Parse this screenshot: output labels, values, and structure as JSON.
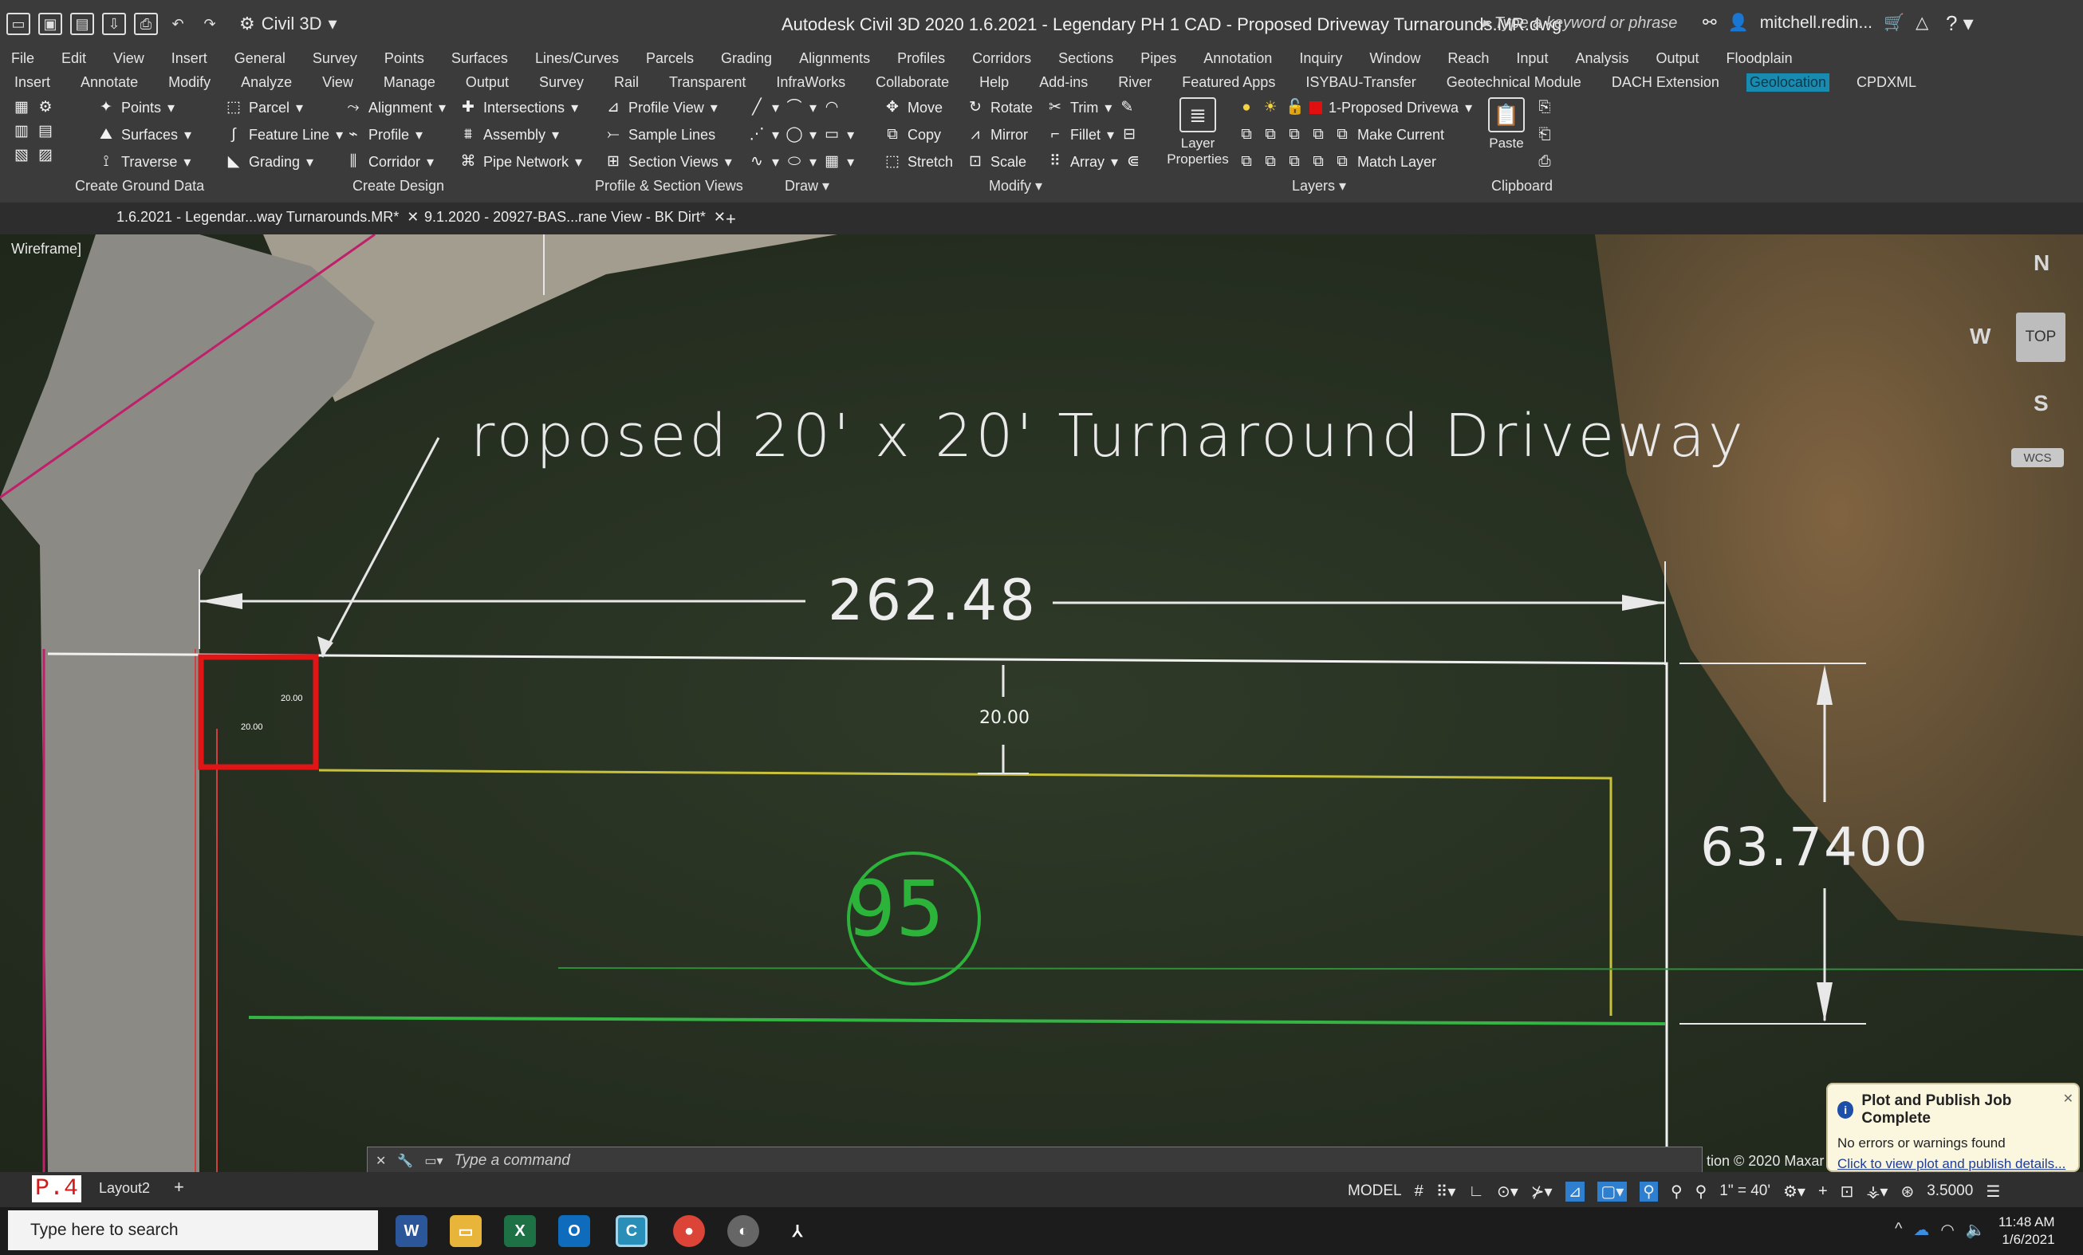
{
  "titlebar": {
    "workspace": "Civil 3D",
    "title": "Autodesk Civil 3D 2020   1.6.2021 - Legendary PH 1 CAD - Proposed Driveway Turnarounds.MR.dwg",
    "search_placeholder": "Type a keyword or phrase",
    "user": "mitchell.redin..."
  },
  "menubar": [
    "File",
    "Edit",
    "View",
    "Insert",
    "General",
    "Survey",
    "Points",
    "Surfaces",
    "Lines/Curves",
    "Parcels",
    "Grading",
    "Alignments",
    "Profiles",
    "Corridors",
    "Sections",
    "Pipes",
    "Annotation",
    "Inquiry",
    "Window",
    "Reach",
    "Input",
    "Analysis",
    "Output",
    "Floodplain"
  ],
  "ribbon_tabs": [
    "Insert",
    "Annotate",
    "Modify",
    "Analyze",
    "View",
    "Manage",
    "Output",
    "Survey",
    "Rail",
    "Transparent",
    "InfraWorks",
    "Collaborate",
    "Help",
    "Add-ins",
    "River",
    "Featured Apps",
    "ISYBAU-Transfer",
    "Geotechnical Module",
    "DACH Extension",
    "Geolocation",
    "CPDXML"
  ],
  "ribbon_active_tab": "Geolocation",
  "ribbon": {
    "ground": [
      "Points",
      "Surfaces",
      "Traverse"
    ],
    "ground_label": "Create Ground Data",
    "design_a": [
      "Parcel",
      "Feature Line",
      "Grading"
    ],
    "design_b": [
      "Alignment",
      "Profile",
      "Corridor"
    ],
    "design_c": [
      "Intersections",
      "Assembly",
      "Pipe Network"
    ],
    "design_label": "Create Design",
    "profile": [
      "Profile View",
      "Sample Lines",
      "Section Views"
    ],
    "profile_label": "Profile & Section Views",
    "draw_label": "Draw",
    "modify_a": [
      "Move",
      "Copy",
      "Stretch"
    ],
    "modify_b": [
      "Rotate",
      "Mirror",
      "Scale"
    ],
    "modify_c": [
      "Trim",
      "Fillet",
      "Array"
    ],
    "modify_label": "Modify",
    "layer_properties": "Layer Properties",
    "current_layer": "1-Proposed Drivewa",
    "make_current": "Make Current",
    "match_layer": "Match Layer",
    "layers_label": "Layers",
    "paste": "Paste",
    "clipboard_label": "Clipboard"
  },
  "doc_tabs": [
    "1.6.2021 - Legendar...way Turnarounds.MR*",
    "9.1.2020 - 20927-BAS...rane View - BK Dirt*"
  ],
  "viewport": {
    "style_label": "Wireframe]",
    "driveway_label": "roposed  20'  x  20'  Turnaround  Driveway",
    "dim_main": "262.48",
    "dim_side": "63.7400",
    "dim_inner": "20.00",
    "dim_small_a": "20.00",
    "dim_small_b": "20.00",
    "lot_number": "95",
    "viewcube": {
      "n": "N",
      "s": "S",
      "w": "W",
      "top": "TOP",
      "wcs": "WCS"
    },
    "attribution": "tion © 2020 Maxar",
    "command_placeholder": "Type a command"
  },
  "notification": {
    "title": "Plot and Publish Job Complete",
    "body": "No errors or warnings found",
    "link": "Click to view plot and publish details..."
  },
  "layout_tabs": [
    "Layout2"
  ],
  "page_mark": "P.4",
  "statusbar": {
    "model": "MODEL",
    "scale": "1\" = 40'",
    "value": "3.5000"
  },
  "taskbar": {
    "search": "Type here to search",
    "time": "11:48 AM",
    "date": "1/6/2021",
    "apps": [
      "word-icon",
      "file-explorer-icon",
      "excel-icon",
      "outlook-icon",
      "civil3d-icon",
      "chrome-icon",
      "app-icon",
      "acrobat-icon"
    ]
  },
  "colors": {
    "accent_tab": "#1a8bb0",
    "lot_green": "#2bb33a",
    "driveway_red": "#e01515",
    "parcel_yellow": "#c8c23a",
    "boundary_magenta": "#c0206a"
  }
}
